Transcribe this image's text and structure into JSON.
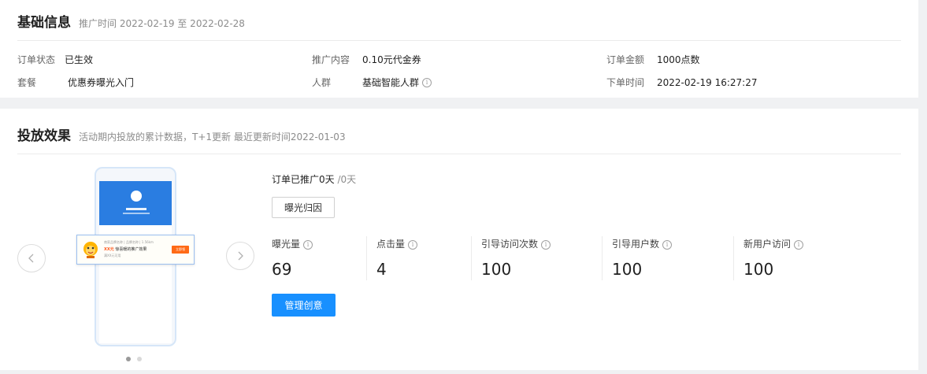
{
  "basic": {
    "title": "基础信息",
    "subtitle": "推广时间 2022-02-19 至 2022-02-28",
    "fields": [
      {
        "label": "订单状态",
        "value": "已生效"
      },
      {
        "label": "推广内容",
        "value": "0.10元代金券"
      },
      {
        "label": "订单金额",
        "value": "1000点数"
      },
      {
        "label": "套餐",
        "value": "优惠券曝光入门"
      },
      {
        "label": "人群",
        "value": "基础智能人群"
      },
      {
        "label": "下单时间",
        "value": "2022-02-19 16:27:27"
      }
    ]
  },
  "effect": {
    "title": "投放效果",
    "subtitle": "活动期内投放的累计数据，T+1更新 最近更新时间2022-01-03",
    "promoted_prefix": "订单已推广0天",
    "promoted_suffix": "/0天",
    "attribution_button": "曝光归因",
    "manage_button": "管理创意",
    "metrics": [
      {
        "label": "曝光量",
        "value": "69"
      },
      {
        "label": "点击量",
        "value": "4"
      },
      {
        "label": "引导访问次数",
        "value": "100"
      },
      {
        "label": "引导用户数",
        "value": "100"
      },
      {
        "label": "新用户访问",
        "value": "100"
      }
    ],
    "preview": {
      "line1": "商家品牌名称 | 品牌名称 | 1.56km",
      "brand": "XX元",
      "line2": "惊喜暖的推广效果",
      "line3": "满XX元可用",
      "button": "立即领"
    },
    "carousel": {
      "pages": 2,
      "current": 1
    }
  },
  "colors": {
    "primary": "#1890ff",
    "accent": "#ff6a16",
    "phone_header": "#2a7de1"
  },
  "icons": {
    "help": "info-circle-icon",
    "prev": "chevron-left-icon",
    "next": "chevron-right-icon"
  }
}
